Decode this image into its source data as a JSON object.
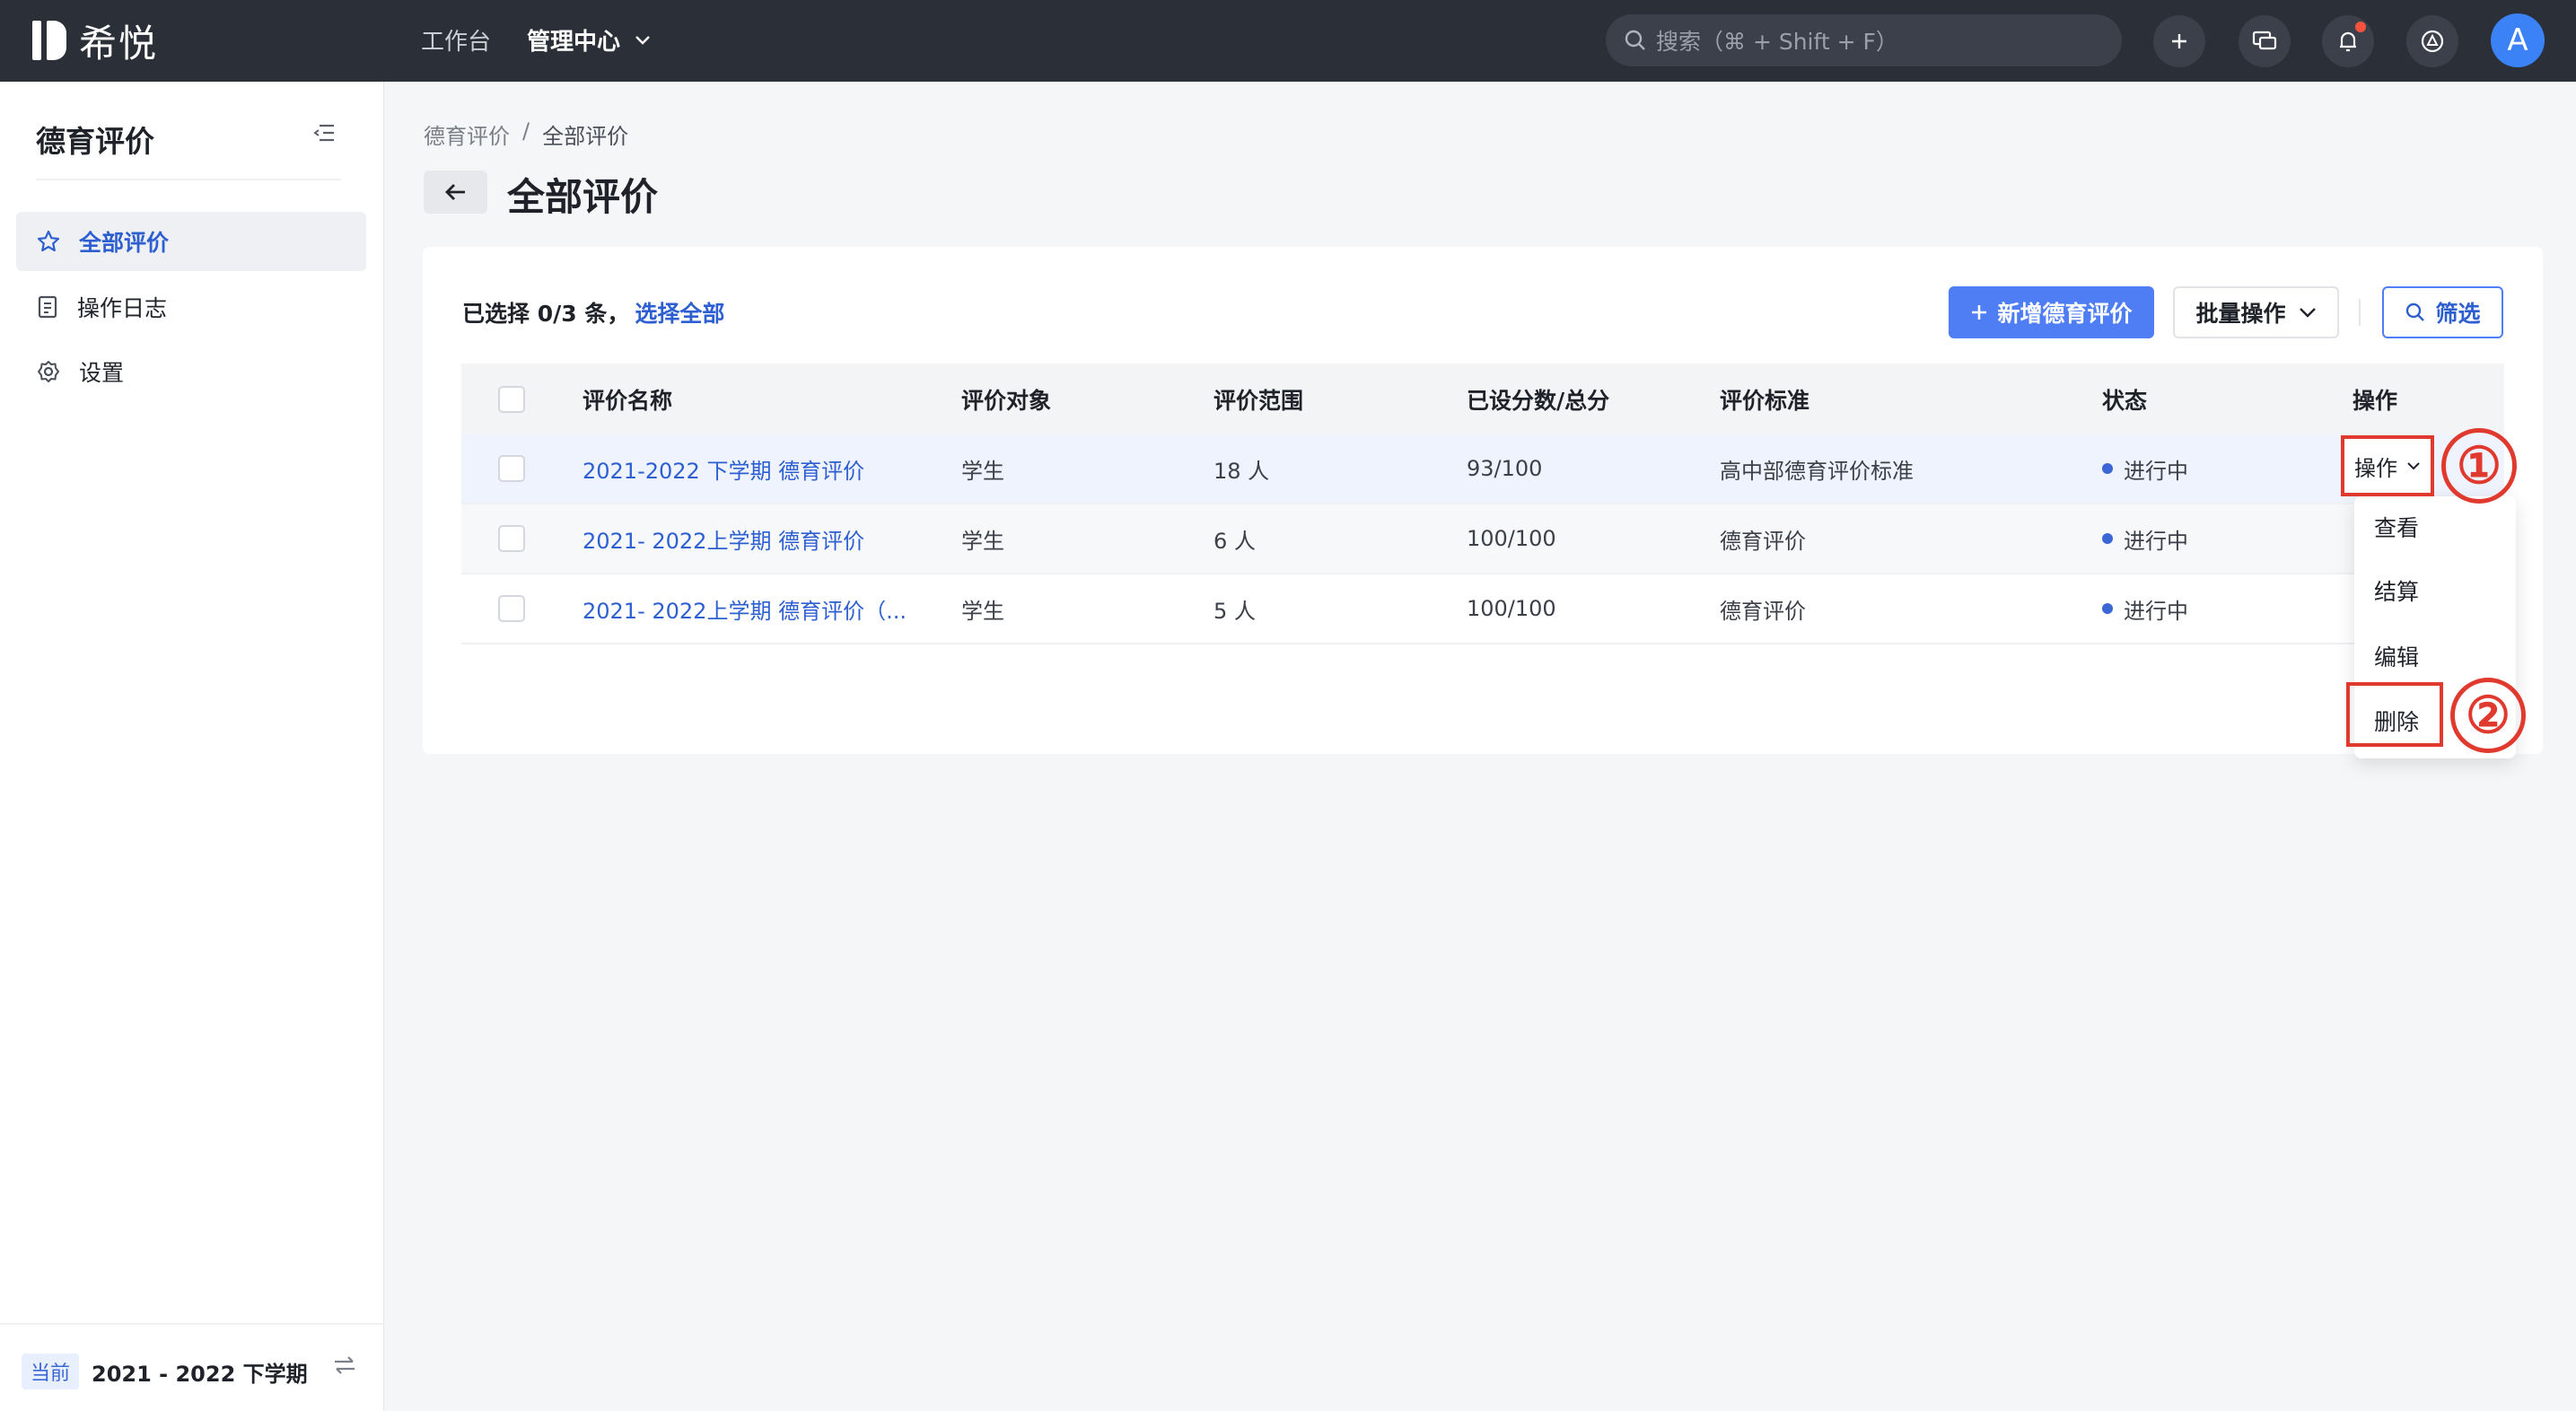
{
  "topbar": {
    "logo_text": "希悦",
    "nav": {
      "workbench": "工作台",
      "admin": "管理中心"
    },
    "search_placeholder": "搜索（⌘ + Shift + F）",
    "avatar_letter": "A"
  },
  "sidebar": {
    "title": "德育评价",
    "items": [
      {
        "label": "全部评价",
        "icon": "star-icon",
        "active": true
      },
      {
        "label": "操作日志",
        "icon": "log-icon",
        "active": false
      },
      {
        "label": "设置",
        "icon": "gear-icon",
        "active": false
      }
    ],
    "footer": {
      "badge": "当前",
      "term": "2021 - 2022 下学期"
    }
  },
  "breadcrumb": {
    "parent": "德育评价",
    "sep": "/",
    "current": "全部评价"
  },
  "page_title": "全部评价",
  "toolbar": {
    "selection_prefix": "已选择 0/3 条，",
    "select_all": "选择全部",
    "add_label": "新增德育评价",
    "batch_label": "批量操作",
    "filter_label": "筛选"
  },
  "table": {
    "headers": {
      "name": "评价名称",
      "target": "评价对象",
      "range": "评价范围",
      "score": "已设分数/总分",
      "standard": "评价标准",
      "status": "状态",
      "op": "操作"
    },
    "rows": [
      {
        "name": "2021-2022 下学期 德育评价",
        "target": "学生",
        "range": "18 人",
        "score": "93/100",
        "standard": "高中部德育评价标准",
        "status": "进行中"
      },
      {
        "name": "2021- 2022上学期 德育评价",
        "target": "学生",
        "range": "6 人",
        "score": "100/100",
        "standard": "德育评价",
        "status": "进行中"
      },
      {
        "name": "2021- 2022上学期 德育评价（...",
        "target": "学生",
        "range": "5 人",
        "score": "100/100",
        "standard": "德育评价",
        "status": "进行中"
      }
    ]
  },
  "op_menu": {
    "trigger": "操作",
    "items": [
      "查看",
      "结算",
      "编辑",
      "删除"
    ]
  },
  "annotations": {
    "step1": "①",
    "step2": "②"
  },
  "colors": {
    "accent": "#4f7df3",
    "link": "#2d5fd1",
    "highlight": "#e03a2f",
    "topbar": "#2b2f38"
  }
}
